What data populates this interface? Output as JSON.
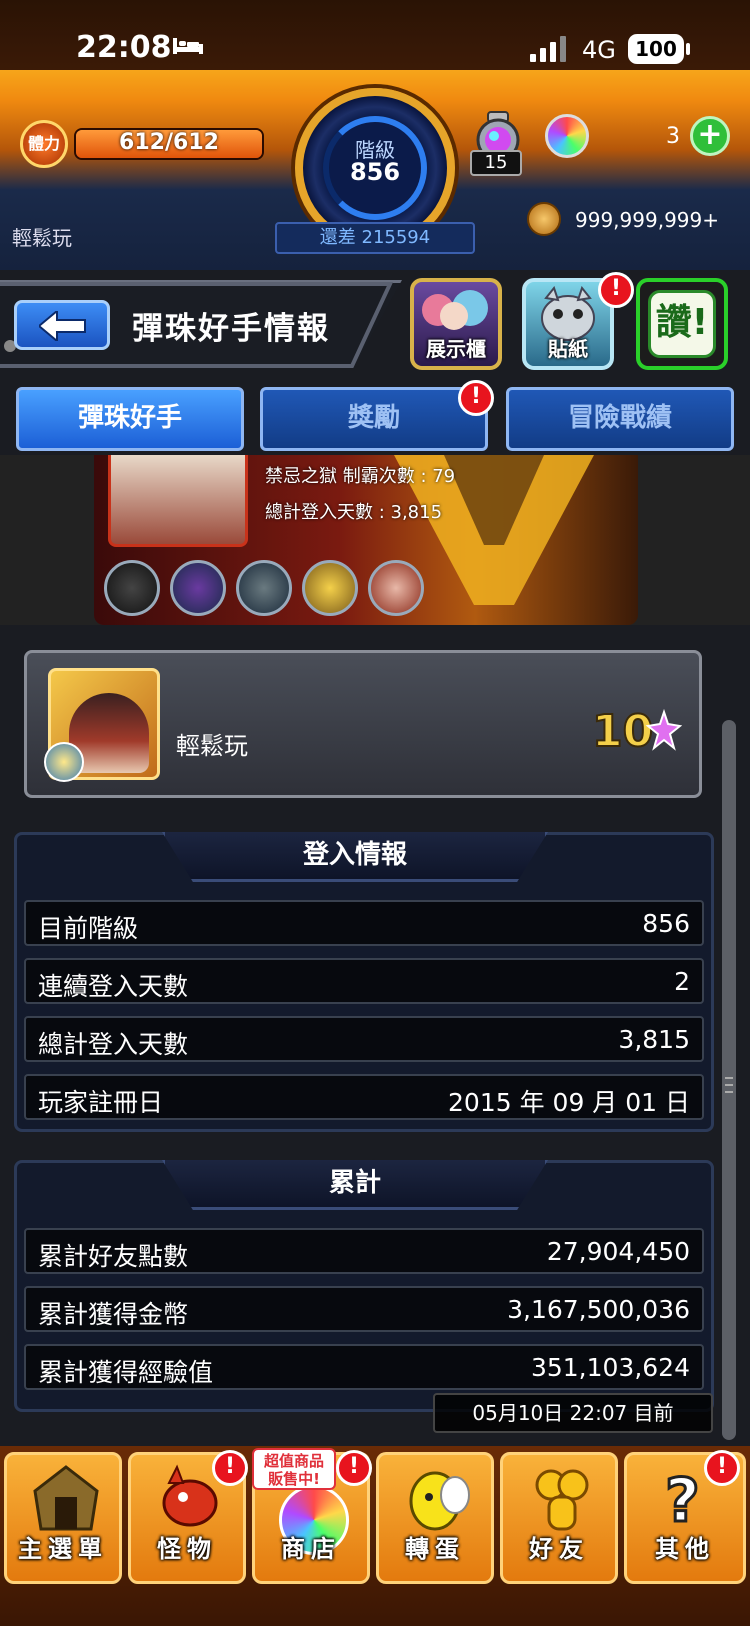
{
  "status_bar": {
    "time": "22:08",
    "network": "4G",
    "battery": "100"
  },
  "hud": {
    "stamina_label": "體力",
    "stamina_text": "612/612",
    "stamina_fraction": 1.0,
    "rank_label": "階級",
    "rank_value": "856",
    "potion_count": "15",
    "orb_count": "3",
    "add_symbol": "+",
    "player_name": "輕鬆玩",
    "rank_diff": "還差 215594",
    "coins": "999,999,999+"
  },
  "title_bar": {
    "title": "彈珠好手情報",
    "showcase_label": "展示櫃",
    "sticker_label": "貼紙",
    "like_label": "讚!",
    "alert_symbol": "!"
  },
  "tabs": [
    {
      "label": "彈珠好手",
      "active": true
    },
    {
      "label": "獎勵",
      "active": false
    },
    {
      "label": "冒險戰績",
      "active": false
    }
  ],
  "banner": {
    "line1": "禁忌之獄 制霸次數 : 79",
    "line2": "總計登入天數 : 3,815"
  },
  "player_card": {
    "name": "輕鬆玩",
    "badge": "10"
  },
  "login_info": {
    "header": "登入情報",
    "rows": [
      {
        "label": "目前階級",
        "value": "856"
      },
      {
        "label": "連續登入天數",
        "value": "2"
      },
      {
        "label": "總計登入天數",
        "value": "3,815"
      },
      {
        "label": "玩家註冊日",
        "value": "2015 年 09 月 01 日"
      }
    ]
  },
  "totals": {
    "header": "累計",
    "rows": [
      {
        "label": "累計好友點數",
        "value": "27,904,450"
      },
      {
        "label": "累計獲得金幣",
        "value": "3,167,500,036"
      },
      {
        "label": "累計獲得經驗值",
        "value": "351,103,624"
      }
    ]
  },
  "timestamp": "05月10日 22:07 目前",
  "bottom_nav": {
    "sale_tag": "超值商品 販售中!",
    "items": [
      {
        "label": "主選單",
        "icon": "menu-icon",
        "alert": false
      },
      {
        "label": "怪物",
        "icon": "monster-icon",
        "alert": true
      },
      {
        "label": "商店",
        "icon": "shop-icon",
        "alert": true
      },
      {
        "label": "轉蛋",
        "icon": "gacha-icon",
        "alert": false
      },
      {
        "label": "好友",
        "icon": "friends-icon",
        "alert": false
      },
      {
        "label": "其他",
        "icon": "other-icon",
        "alert": true
      }
    ]
  },
  "colors": {
    "accent_blue": "#1c5fd6",
    "alert_red": "#e8141e",
    "nav_orange": "#e37a0e",
    "like_green": "#2ad02a"
  }
}
